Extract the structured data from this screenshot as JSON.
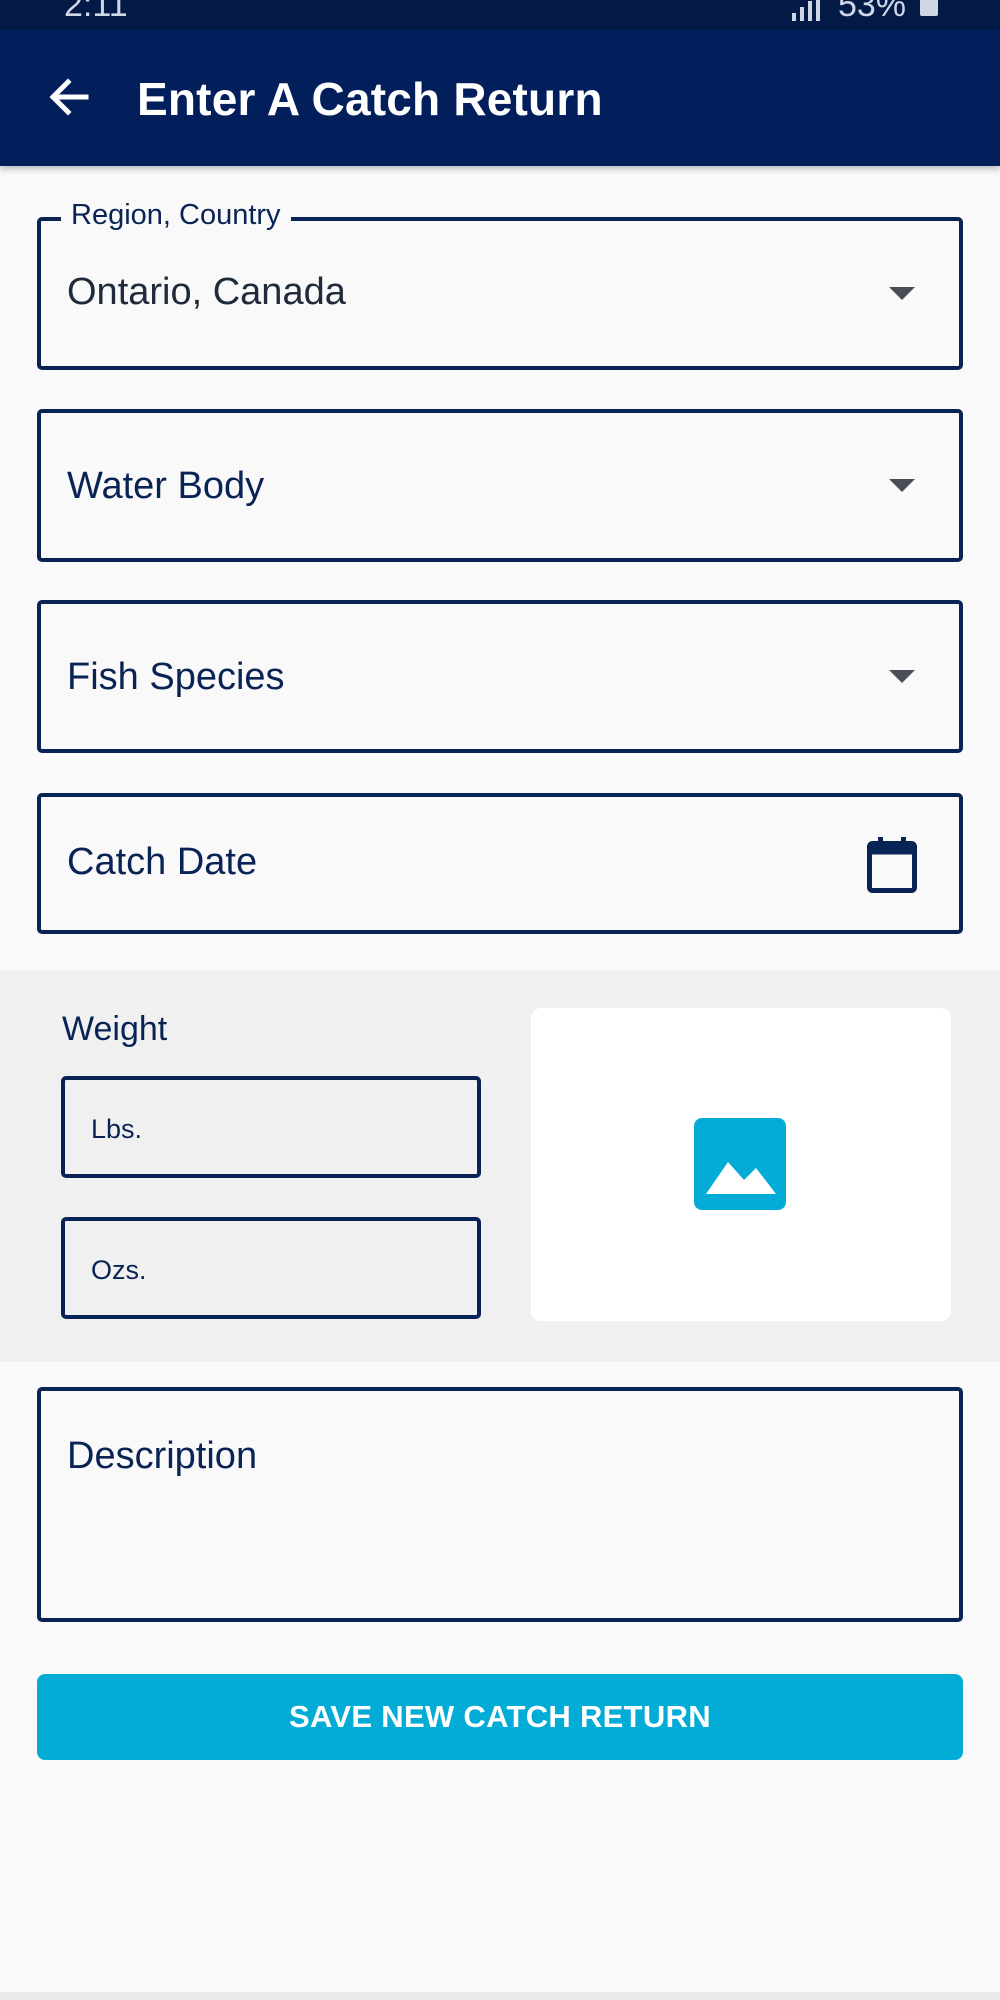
{
  "status_bar": {
    "time": "2:11",
    "battery": "53%"
  },
  "app_bar": {
    "title": "Enter A Catch Return",
    "back_icon": "arrow-left-icon"
  },
  "form": {
    "region": {
      "label": "Region, Country",
      "value": "Ontario, Canada"
    },
    "water_body": {
      "placeholder": "Water Body"
    },
    "fish_species": {
      "placeholder": "Fish Species"
    },
    "catch_date": {
      "placeholder": "Catch Date"
    },
    "weight": {
      "label": "Weight",
      "lbs_placeholder": "Lbs.",
      "ozs_placeholder": "Ozs."
    },
    "photo": {
      "icon": "image-icon"
    },
    "description": {
      "placeholder": "Description"
    },
    "save_label": "SAVE NEW CATCH RETURN"
  },
  "colors": {
    "primary_dark": "#021f5c",
    "accent": "#02acd6",
    "border": "#0a2355"
  }
}
